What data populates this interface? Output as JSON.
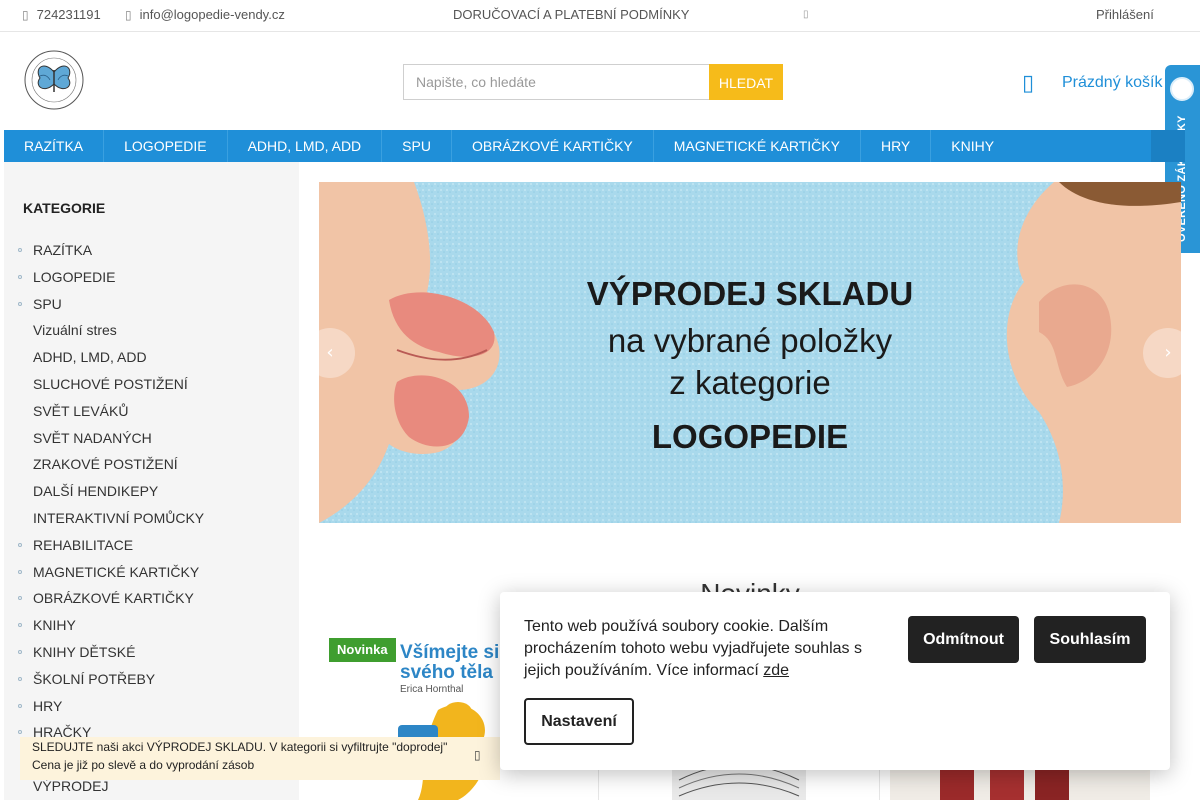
{
  "topbar": {
    "phone": "724231191",
    "email": "info@logopedie-vendy.cz",
    "delivery_link": "DORUČOVACÍ A PLATEBNÍ PODMÍNKY",
    "login": "Přihlášení",
    "icons": [
      "phone-icon",
      "mail-icon",
      "social-icon"
    ]
  },
  "header": {
    "logo_text": "LOGOPEDIE VENDY",
    "search_placeholder": "Napište, co hledáte",
    "search_button": "HLEDAT",
    "cart_label": "Prázdný košík",
    "verified_badge": "OVĚŘENO ZÁKAZNÍKY"
  },
  "nav": {
    "items": [
      "RAZÍTKA",
      "LOGOPEDIE",
      "ADHD, LMD, ADD",
      "SPU",
      "OBRÁZKOVÉ KARTIČKY",
      "MAGNETICKÉ KARTIČKY",
      "HRY",
      "KNIHY"
    ]
  },
  "sidebar": {
    "title": "KATEGORIE",
    "items": [
      {
        "label": "RAZÍTKA",
        "bullet": true
      },
      {
        "label": "LOGOPEDIE",
        "bullet": true
      },
      {
        "label": "SPU",
        "bullet": true
      },
      {
        "label": "Vizuální stres",
        "bullet": false
      },
      {
        "label": "ADHD, LMD, ADD",
        "bullet": false
      },
      {
        "label": "SLUCHOVÉ POSTIŽENÍ",
        "bullet": false
      },
      {
        "label": "SVĚT LEVÁKŮ",
        "bullet": false
      },
      {
        "label": "SVĚT NADANÝCH",
        "bullet": false
      },
      {
        "label": "ZRAKOVÉ POSTIŽENÍ",
        "bullet": false
      },
      {
        "label": "DALŠÍ HENDIKEPY",
        "bullet": false
      },
      {
        "label": "INTERAKTIVNÍ POMŮCKY",
        "bullet": false
      },
      {
        "label": "REHABILITACE",
        "bullet": true
      },
      {
        "label": "MAGNETICKÉ KARTIČKY",
        "bullet": true
      },
      {
        "label": "OBRÁZKOVÉ KARTIČKY",
        "bullet": true
      },
      {
        "label": "KNIHY",
        "bullet": true
      },
      {
        "label": "KNIHY DĚTSKÉ",
        "bullet": true
      },
      {
        "label": "ŠKOLNÍ POTŘEBY",
        "bullet": true
      },
      {
        "label": "HRY",
        "bullet": true
      },
      {
        "label": "HRAČKY",
        "bullet": true
      },
      {
        "label": "",
        "bullet": false
      },
      {
        "label": "VÝPRODEJ",
        "bullet": false
      }
    ]
  },
  "banner": {
    "line1": "VÝPRODEJ SKLADU",
    "line2": "na vybrané položky",
    "line3": "z kategorie",
    "line4": "LOGOPEDIE",
    "colors": {
      "background": "#a9d9ec",
      "lips": "#e88a7e",
      "skin": "#f1c4a6"
    }
  },
  "section": {
    "title": "Novinky"
  },
  "products": {
    "badge": "Novinka",
    "book_title_line1": "Všímejte si",
    "book_title_line2": "svého těla",
    "book_author": "Erica Hornthal"
  },
  "promo": {
    "line1": "SLEDUJTE naši akci VÝPRODEJ SKLADU. V kategorii si vyfiltrujte \"doprodej\"",
    "line2": "Cena je již po slevě a do vyprodání zásob",
    "close_icon": "close-icon"
  },
  "cookie": {
    "text": "Tento web používá soubory cookie. Dalším procházením tohoto webu vyjadřujete souhlas s jejich používáním. Více informací",
    "link": "zde",
    "decline": "Odmítnout",
    "accept": "Souhlasím",
    "settings": "Nastavení"
  },
  "colors": {
    "brand_blue": "#1f8fd8",
    "search_button": "#f6bb1a",
    "novinka_green": "#3f9e2f",
    "sidebar_bg": "#f5f5f5",
    "promo_bg": "#fdf3dc"
  }
}
